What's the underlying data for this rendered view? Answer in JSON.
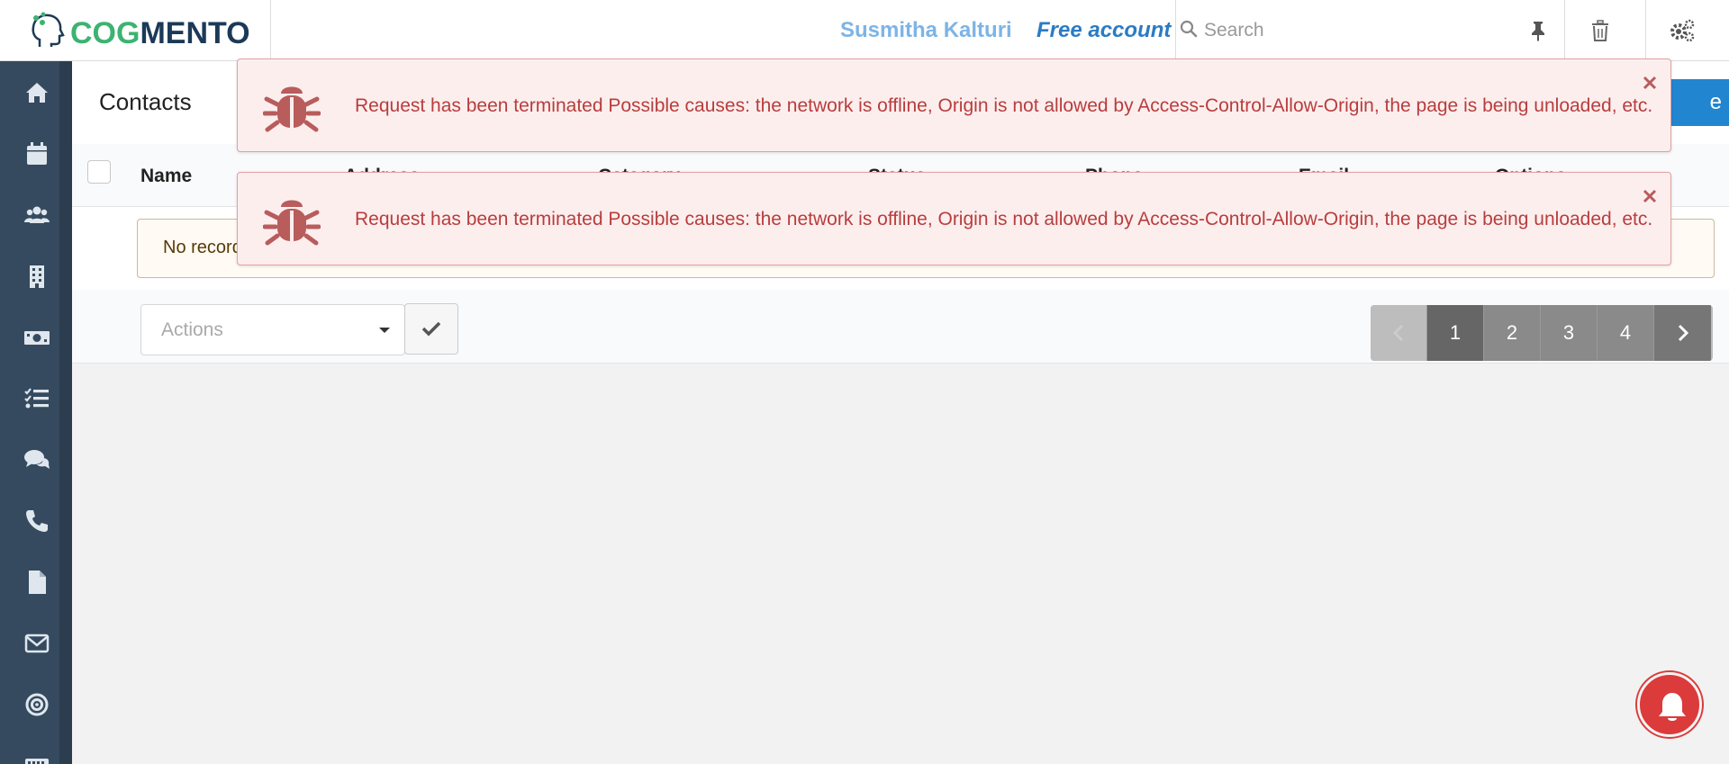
{
  "header": {
    "logo_cog": "COG",
    "logo_mento": "MENTO",
    "user_name": "Susmitha Kalturi",
    "account_type": "Free account",
    "search_placeholder": "Search"
  },
  "sidebar": {
    "icons": [
      "home-icon",
      "calendar-icon",
      "contacts-icon",
      "company-icon",
      "deals-icon",
      "tasks-icon",
      "chat-icon",
      "phone-icon",
      "document-icon",
      "email-icon",
      "target-icon",
      "keyboard-icon"
    ]
  },
  "page": {
    "title": "Contacts",
    "create_label": "e"
  },
  "table": {
    "columns": [
      "Name",
      "Address",
      "Category",
      "Status",
      "Phone",
      "Email",
      "Options"
    ],
    "empty_message": "No records found"
  },
  "footer": {
    "actions_placeholder": "Actions",
    "pages": [
      "1",
      "2",
      "3",
      "4"
    ],
    "active_page": "1"
  },
  "toasts": [
    {
      "message": "Request has been terminated Possible causes: the network is offline, Origin is not allowed by Access-Control-Allow-Origin, the page is being unloaded, etc."
    },
    {
      "message": "Request has been terminated Possible causes: the network is offline, Origin is not allowed by Access-Control-Allow-Origin, the page is being unloaded, etc."
    }
  ],
  "colors": {
    "brand_green": "#3cb371",
    "brand_navy": "#1c3a57",
    "sidebar": "#354a5f",
    "error_text": "#b83d3d",
    "error_bg": "#fdeeee",
    "primary": "#2185d0",
    "bell": "#db3b3b"
  }
}
